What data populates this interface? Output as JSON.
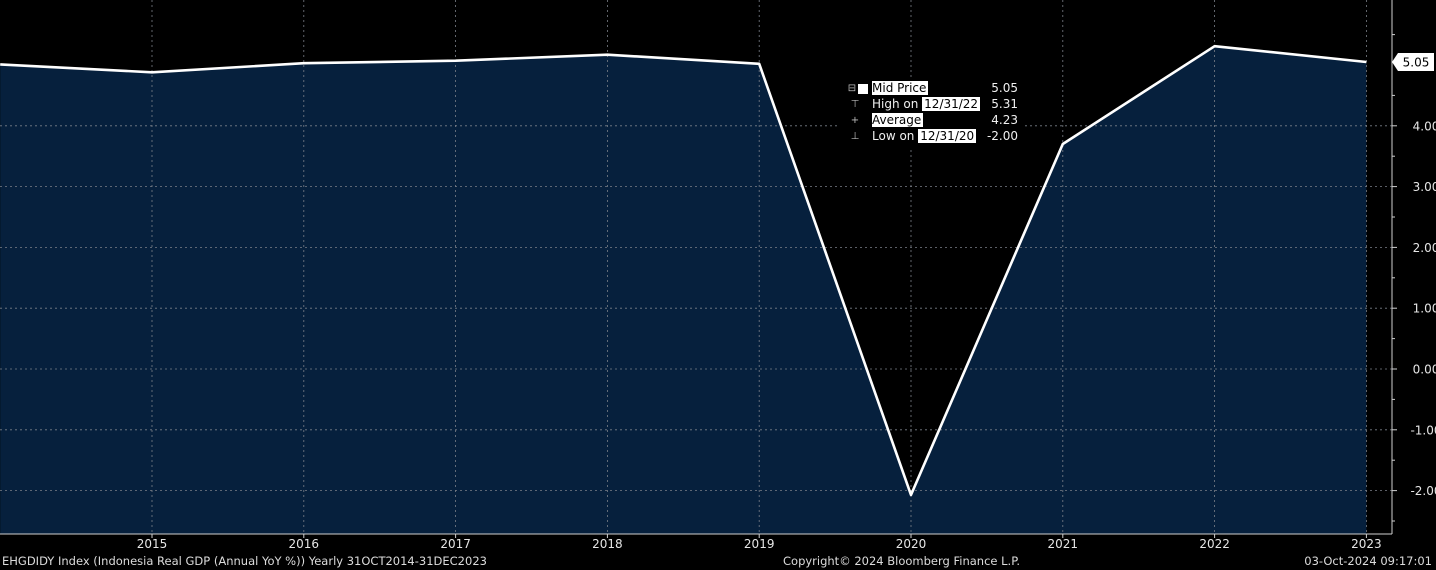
{
  "chart_data": {
    "type": "area",
    "x": [
      "2014",
      "2015",
      "2016",
      "2017",
      "2018",
      "2019",
      "2020",
      "2021",
      "2022",
      "2023"
    ],
    "values": [
      5.01,
      4.88,
      5.03,
      5.07,
      5.17,
      5.02,
      -2.07,
      3.7,
      5.31,
      5.05
    ],
    "x_tick_labels": [
      "2015",
      "2016",
      "2017",
      "2018",
      "2019",
      "2020",
      "2021",
      "2022",
      "2023"
    ],
    "y_tick_labels": [
      "-2.00",
      "-1.00",
      "0.00",
      "1.00",
      "2.00",
      "3.00",
      "4.00"
    ],
    "ylim": [
      -2.7,
      6.0
    ],
    "last_value_label": "5.05",
    "grid": true,
    "fill_color": "#06203d",
    "line_color": "#ffffff",
    "background_color": "#000000",
    "legend": {
      "placement": "top-center",
      "rows": [
        {
          "label": "Mid Price",
          "date": "",
          "value": "5.05"
        },
        {
          "label": "High on",
          "date": "12/31/22",
          "value": "5.31"
        },
        {
          "label": "Average",
          "date": "",
          "value": "4.23"
        },
        {
          "label": "Low on",
          "date": "12/31/20",
          "value": "-2.00"
        }
      ]
    }
  },
  "footer": {
    "left": "EHGDIDY Index (Indonesia Real GDP (Annual YoY %))  Yearly 31OCT2014-31DEC2023",
    "center": "Copyright© 2024 Bloomberg Finance L.P.",
    "right": "03-Oct-2024 09:17:01"
  }
}
